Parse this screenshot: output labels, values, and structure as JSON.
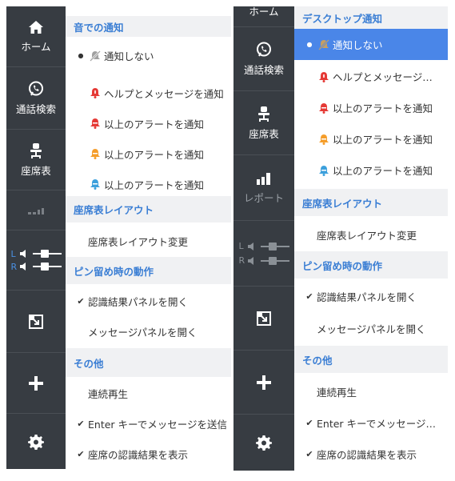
{
  "left": {
    "nav": {
      "home_label": "ホーム",
      "call_search_label": "通話検索",
      "seat_chart_label": "座席表"
    },
    "menu": {
      "section_notify": "音での通知",
      "notify_none": "通知しない",
      "notify_help": "ヘルプとメッセージを通知",
      "notify_red": "以上のアラートを通知",
      "notify_orange": "以上のアラートを通知",
      "notify_blue": "以上のアラートを通知",
      "section_layout": "座席表レイアウト",
      "layout_change": "座席表レイアウト変更",
      "section_pin": "ピン留め時の動作",
      "pin_open_result": "認識結果パネルを開く",
      "pin_open_message": "メッセージパネルを開く",
      "section_other": "その他",
      "other_continuous": "連続再生",
      "other_enter_send": "Enter キーでメッセージを送信",
      "other_show_seat": "座席の認識結果を表示"
    }
  },
  "right": {
    "nav": {
      "home_label": "ホーム",
      "call_search_label": "通話検索",
      "seat_chart_label": "座席表",
      "report_label": "レポート"
    },
    "menu": {
      "section_notify": "デスクトップ通知",
      "notify_none": "通知しない",
      "notify_help": "ヘルプとメッセージ…",
      "notify_red": "以上のアラートを通知",
      "notify_orange": "以上のアラートを通知",
      "notify_blue": "以上のアラートを通知",
      "section_layout": "座席表レイアウト",
      "layout_change": "座席表レイアウト変更",
      "section_pin": "ピン留め時の動作",
      "pin_open_result": "認識結果パネルを開く",
      "pin_open_message": "メッセージパネルを開く",
      "section_other": "その他",
      "other_continuous": "連続再生",
      "other_enter_send": "Enter キーでメッセージ…",
      "other_show_seat": "座席の認識結果を表示"
    }
  },
  "lr_labels": {
    "l": "L",
    "r": "R"
  },
  "marks": {
    "bullet": "●",
    "check": "✔"
  },
  "colors": {
    "sidebar": "#373c42",
    "section_text": "#3a7ed4",
    "section_bg": "#f0f1f3",
    "selected_bg": "#4a86e8",
    "bell_red": "#e53935",
    "bell_orange": "#f59d2a",
    "bell_blue": "#3ca0dc"
  },
  "icons": [
    "home-icon",
    "phone-search-icon",
    "seat-chair-icon",
    "report-chart-icon",
    "volume-lr-icon",
    "popout-icon",
    "plus-icon",
    "gear-icon",
    "bell-icon",
    "muted-bell-icon"
  ]
}
